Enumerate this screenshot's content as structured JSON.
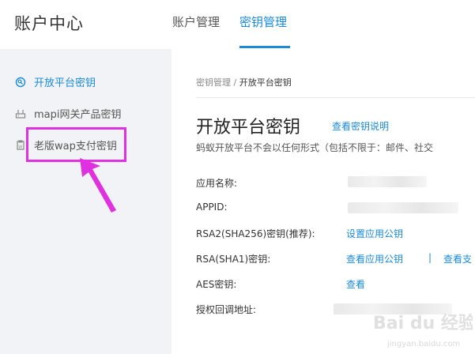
{
  "header": {
    "app_title": "账户中心",
    "tabs": [
      {
        "label": "账户管理",
        "active": false
      },
      {
        "label": "密钥管理",
        "active": true
      }
    ]
  },
  "sidebar": {
    "items": [
      {
        "label": "开放平台密钥",
        "icon": "key-search-icon",
        "active": true
      },
      {
        "label": "mapi网关产品密钥",
        "icon": "gateway-icon",
        "active": false
      },
      {
        "label": "老版wap支付密钥",
        "icon": "wap-icon",
        "active": false
      }
    ]
  },
  "breadcrumb": {
    "parent": "密钥管理",
    "separator": "/",
    "current": "开放平台密钥"
  },
  "main": {
    "title": "开放平台密钥",
    "help_link": "查看密钥说明",
    "notice": "蚂蚁开放平台不会以任何形式（包括不限于：邮件、社交",
    "fields": [
      {
        "label": "应用名称:"
      },
      {
        "label": "APPID:"
      },
      {
        "label": "RSA2(SHA256)密钥(推荐):",
        "link": "设置应用公钥"
      },
      {
        "label": "RSA(SHA1)密钥:",
        "link": "查看应用公钥",
        "separator": "|",
        "link2": "查看支"
      },
      {
        "label": "AES密钥:",
        "link": "查看"
      },
      {
        "label": "授权回调地址:"
      }
    ]
  },
  "watermark": {
    "text": "Bai du 经验",
    "sub": "jingyan.baidu.com"
  },
  "colors": {
    "accent": "#1a8ad8",
    "highlight": "#e031e0",
    "sidebar_bg": "#f2f3f6"
  }
}
